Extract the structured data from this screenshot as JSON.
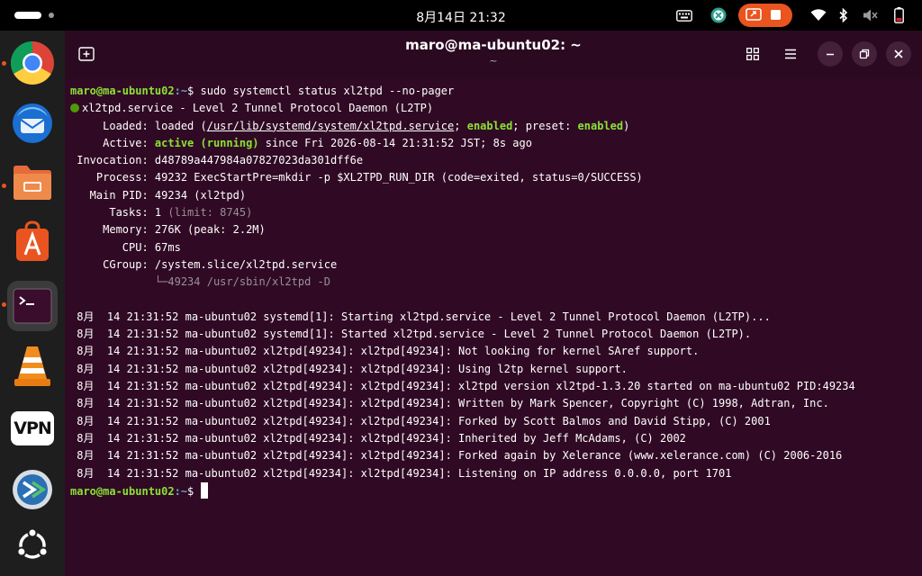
{
  "topbar": {
    "clock": "8月14日  21:32",
    "icons": [
      "keyboard-icon",
      "app-indicator-icon",
      "screencast-icon",
      "wifi-icon",
      "bluetooth-icon",
      "volume-muted-icon",
      "battery-icon"
    ],
    "cast_color": "#e9541f"
  },
  "dock": {
    "items": [
      "chrome",
      "thunderbird",
      "files",
      "app-center",
      "terminal",
      "vlc",
      "vpn",
      "remmina",
      "show-apps"
    ],
    "vpn_label": "VPN"
  },
  "window": {
    "title": "maro@ma-ubuntu02: ~",
    "subtitle": "~",
    "background": "#300a24"
  },
  "terminal": {
    "prompt_user": "maro@ma-ubuntu02",
    "prompt_path": ":~",
    "prompt_sigil": "$ ",
    "command": "sudo systemctl status xl2tpd --no-pager",
    "service_line": "xl2tpd.service - Level 2 Tunnel Protocol Daemon (L2TP)",
    "loaded": {
      "label": "     Loaded: ",
      "pre": "loaded (",
      "path": "/usr/lib/systemd/system/xl2tpd.service",
      "sep": "; ",
      "enabled": "enabled",
      "mid": "; preset: ",
      "preset": "enabled",
      "post": ")"
    },
    "active": {
      "label": "     Active: ",
      "state": "active (running)",
      "since": " since Fri 2026-08-14 21:31:52 JST; 8s ago"
    },
    "invocation": " Invocation: d48789a447984a07827023da301dff6e",
    "process": "    Process: 49232 ExecStartPre=mkdir -p $XL2TPD_RUN_DIR (code=exited, status=0/SUCCESS)",
    "main_pid": "   Main PID: 49234 (xl2tpd)",
    "tasks": {
      "label": "      Tasks: 1 ",
      "limit": "(limit: 8745)"
    },
    "memory": "     Memory: 276K (peak: 2.2M)",
    "cpu": "        CPU: 67ms",
    "cgroup": "     CGroup: /system.slice/xl2tpd.service",
    "cgroup_child": "             └─49234 /usr/sbin/xl2tpd -D",
    "logs": [
      " 8月  14 21:31:52 ma-ubuntu02 systemd[1]: Starting xl2tpd.service - Level 2 Tunnel Protocol Daemon (L2TP)...",
      " 8月  14 21:31:52 ma-ubuntu02 systemd[1]: Started xl2tpd.service - Level 2 Tunnel Protocol Daemon (L2TP).",
      " 8月  14 21:31:52 ma-ubuntu02 xl2tpd[49234]: xl2tpd[49234]: Not looking for kernel SAref support.",
      " 8月  14 21:31:52 ma-ubuntu02 xl2tpd[49234]: xl2tpd[49234]: Using l2tp kernel support.",
      " 8月  14 21:31:52 ma-ubuntu02 xl2tpd[49234]: xl2tpd[49234]: xl2tpd version xl2tpd-1.3.20 started on ma-ubuntu02 PID:49234",
      " 8月  14 21:31:52 ma-ubuntu02 xl2tpd[49234]: xl2tpd[49234]: Written by Mark Spencer, Copyright (C) 1998, Adtran, Inc.",
      " 8月  14 21:31:52 ma-ubuntu02 xl2tpd[49234]: xl2tpd[49234]: Forked by Scott Balmos and David Stipp, (C) 2001",
      " 8月  14 21:31:52 ma-ubuntu02 xl2tpd[49234]: xl2tpd[49234]: Inherited by Jeff McAdams, (C) 2002",
      " 8月  14 21:31:52 ma-ubuntu02 xl2tpd[49234]: xl2tpd[49234]: Forked again by Xelerance (www.xelerance.com) (C) 2006-2016",
      " 8月  14 21:31:52 ma-ubuntu02 xl2tpd[49234]: xl2tpd[49234]: Listening on IP address 0.0.0.0, port 1701"
    ]
  }
}
